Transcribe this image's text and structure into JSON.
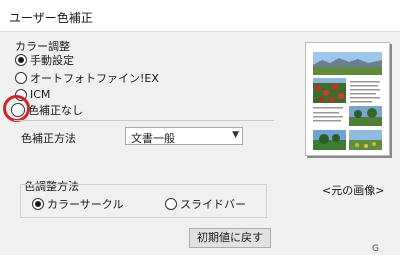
{
  "window": {
    "title": "ユーザー色補正"
  },
  "color_adjust": {
    "label": "カラー調整",
    "options": [
      {
        "label": "手動設定",
        "selected": true
      },
      {
        "label": "オートフォトファイン!EX",
        "selected": false
      },
      {
        "label": "ICM",
        "selected": false
      },
      {
        "label": "色補正なし",
        "selected": false
      }
    ]
  },
  "correction_method": {
    "label": "色補正方法",
    "value": "文書一般"
  },
  "adjust_method": {
    "label": "色調整方法",
    "options": [
      {
        "label": "カラーサークル",
        "selected": true
      },
      {
        "label": "スライドバー",
        "selected": false
      }
    ]
  },
  "reset_button": {
    "label": "初期値に戻す"
  },
  "preview": {
    "caption": "<元の画像>"
  },
  "corner": {
    "text": "G"
  },
  "colors": {
    "highlight_ring": "#d2232a",
    "background": "#f0f0f0"
  }
}
